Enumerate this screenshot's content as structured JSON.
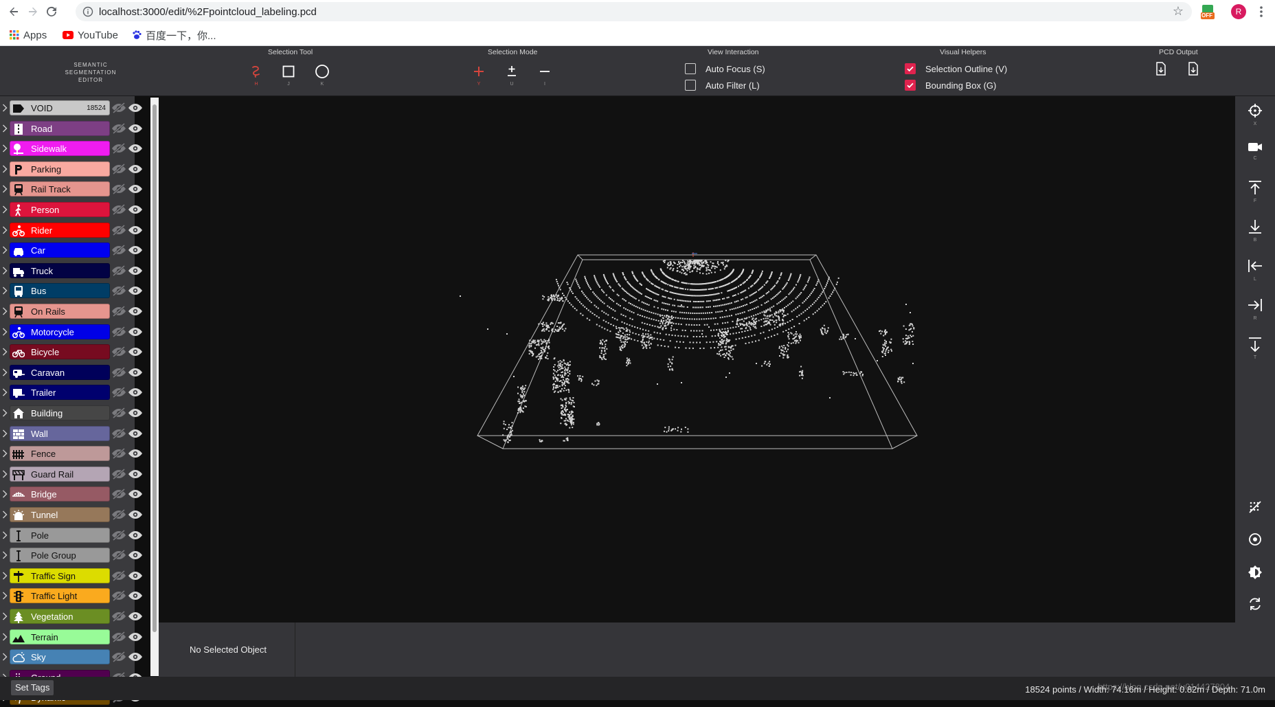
{
  "browser": {
    "url": "localhost:3000/edit/%2Fpointcloud_labeling.pcd",
    "avatar_letter": "R",
    "extension_badge": "OFF",
    "bookmarks": [
      {
        "label": "Apps",
        "icon": "apps-grid-icon"
      },
      {
        "label": "YouTube",
        "icon": "youtube-icon"
      },
      {
        "label": "百度一下，你...",
        "icon": "baidu-paw-icon"
      }
    ]
  },
  "app": {
    "logo_lines": [
      "SEMANTIC",
      "SEGMENTATION",
      "EDITOR"
    ],
    "toolbar": {
      "selection_tool": {
        "title": "Selection Tool",
        "tools": [
          {
            "key": "H",
            "icon": "lasso-icon",
            "active": true
          },
          {
            "key": "J",
            "icon": "rectangle-icon"
          },
          {
            "key": "K",
            "icon": "circle-icon"
          }
        ]
      },
      "selection_mode": {
        "title": "Selection Mode",
        "tools": [
          {
            "key": "Y",
            "icon": "plus-icon",
            "active": true
          },
          {
            "key": "U",
            "icon": "plus-minus-icon"
          },
          {
            "key": "I",
            "icon": "minus-icon"
          }
        ]
      },
      "view_interaction": {
        "title": "View Interaction",
        "options": [
          {
            "label": "Auto Focus (S)",
            "checked": false
          },
          {
            "label": "Auto Filter (L)",
            "checked": false
          }
        ]
      },
      "visual_helpers": {
        "title": "Visual Helpers",
        "options": [
          {
            "label": "Selection Outline (V)",
            "checked": true
          },
          {
            "label": "Bounding Box (G)",
            "checked": true
          }
        ]
      },
      "pcd_output": {
        "title": "PCD Output",
        "buttons": [
          "file-export-icon",
          "file-download-icon"
        ]
      }
    },
    "labels": [
      {
        "name": "VOID",
        "color": "#c8c8c8",
        "text": "#111111",
        "count": "18524",
        "icon": "tag-icon"
      },
      {
        "name": "Road",
        "color": "#7d3f84",
        "text": "#ffffff",
        "icon": "road-icon"
      },
      {
        "name": "Sidewalk",
        "color": "#f01cf0",
        "text": "#ffffff",
        "icon": "tree-bench-icon"
      },
      {
        "name": "Parking",
        "color": "#f9a9a0",
        "text": "#111111",
        "icon": "parking-icon"
      },
      {
        "name": "Rail Track",
        "color": "#e5958e",
        "text": "#111111",
        "icon": "train-icon"
      },
      {
        "name": "Person",
        "color": "#dc143c",
        "text": "#ffffff",
        "icon": "walking-person-icon"
      },
      {
        "name": "Rider",
        "color": "#ff0000",
        "text": "#ffffff",
        "icon": "motorcycle-rider-icon"
      },
      {
        "name": "Car",
        "color": "#0000f0",
        "text": "#ffffff",
        "icon": "car-icon"
      },
      {
        "name": "Truck",
        "color": "#020244",
        "text": "#ffffff",
        "icon": "truck-icon"
      },
      {
        "name": "Bus",
        "color": "#003d66",
        "text": "#ffffff",
        "icon": "bus-icon"
      },
      {
        "name": "On Rails",
        "color": "#e5958e",
        "text": "#111111",
        "icon": "tram-icon"
      },
      {
        "name": "Motorcycle",
        "color": "#0000e6",
        "text": "#ffffff",
        "icon": "motorcycle-icon"
      },
      {
        "name": "Bicycle",
        "color": "#770b20",
        "text": "#ffffff",
        "icon": "bicycle-icon"
      },
      {
        "name": "Caravan",
        "color": "#00005a",
        "text": "#ffffff",
        "icon": "caravan-icon"
      },
      {
        "name": "Trailer",
        "color": "#00006e",
        "text": "#ffffff",
        "icon": "trailer-icon"
      },
      {
        "name": "Building",
        "color": "#464646",
        "text": "#ffffff",
        "icon": "house-icon"
      },
      {
        "name": "Wall",
        "color": "#66669c",
        "text": "#ffffff",
        "icon": "brick-wall-icon"
      },
      {
        "name": "Fence",
        "color": "#be9999",
        "text": "#111111",
        "icon": "fence-icon"
      },
      {
        "name": "Guard Rail",
        "color": "#b4a5b4",
        "text": "#111111",
        "icon": "guard-rail-icon"
      },
      {
        "name": "Bridge",
        "color": "#965a64",
        "text": "#ffffff",
        "icon": "bridge-icon"
      },
      {
        "name": "Tunnel",
        "color": "#96785a",
        "text": "#ffffff",
        "icon": "tunnel-light-icon"
      },
      {
        "name": "Pole",
        "color": "#999999",
        "text": "#111111",
        "icon": "pole-icon"
      },
      {
        "name": "Pole Group",
        "color": "#999999",
        "text": "#111111",
        "icon": "pole-icon"
      },
      {
        "name": "Traffic Sign",
        "color": "#dcdc00",
        "text": "#111111",
        "icon": "signpost-icon"
      },
      {
        "name": "Traffic Light",
        "color": "#faaa1e",
        "text": "#111111",
        "icon": "traffic-light-icon"
      },
      {
        "name": "Vegetation",
        "color": "#6b8e23",
        "text": "#ffffff",
        "icon": "pine-tree-icon"
      },
      {
        "name": "Terrain",
        "color": "#98fb98",
        "text": "#111111",
        "icon": "mountain-icon"
      },
      {
        "name": "Sky",
        "color": "#4682b4",
        "text": "#ffffff",
        "icon": "cloud-sun-icon"
      },
      {
        "name": "Ground",
        "color": "#51004f",
        "text": "#ffffff",
        "icon": "dots-grid-icon"
      },
      {
        "name": "Dynamic",
        "color": "#6f4a00",
        "text": "#ffffff",
        "icon": "running-person-icon"
      }
    ],
    "right_tools": [
      {
        "key": "X",
        "icon": "crosshair-icon"
      },
      {
        "key": "C",
        "icon": "video-camera-icon"
      },
      {
        "key": "F",
        "icon": "arrow-to-top-icon"
      },
      {
        "key": "B",
        "icon": "arrow-to-bottom-icon"
      },
      {
        "key": "L",
        "icon": "arrow-to-left-icon"
      },
      {
        "key": "R",
        "icon": "arrow-to-right-icon"
      },
      {
        "key": "T",
        "icon": "arrow-down-to-line-icon"
      }
    ],
    "right_tools_bottom": [
      "hide-points-icon",
      "target-dot-icon",
      "brightness-icon",
      "sync-icon"
    ],
    "bottom_panel": {
      "no_selection": "No Selected Object"
    },
    "status": {
      "set_tags": "Set Tags",
      "info": "18524 points / Width: 74.16m / Height: 0.82m / Depth: 71.0m",
      "watermark": "https://blog.csdn.net/u014427804"
    },
    "colors": {
      "accent": "#e0234e",
      "toolbar": "#353539",
      "viewport": "#111111"
    }
  }
}
